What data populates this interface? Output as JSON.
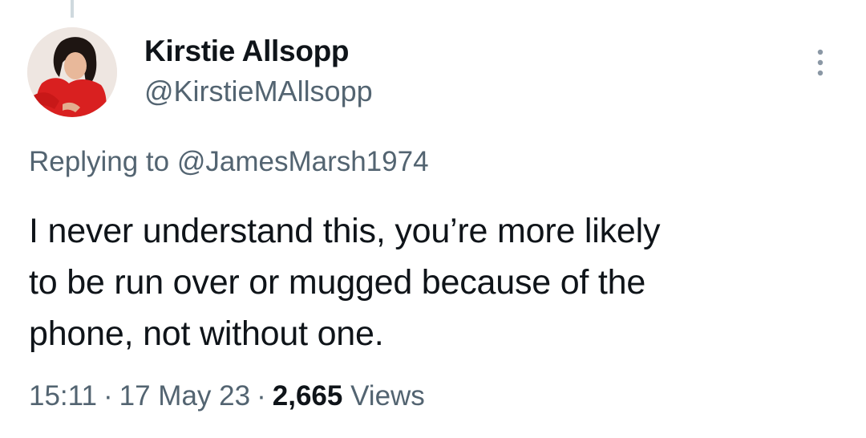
{
  "author": {
    "display_name": "Kirstie Allsopp",
    "handle": "@KirstieMAllsopp"
  },
  "reply": {
    "prefix": "Replying to ",
    "to_handle": "@JamesMarsh1974"
  },
  "tweet": {
    "text": "I never understand this, you’re more likely\nto be run over or mugged because of the\nphone, not without one."
  },
  "meta": {
    "time": "15:11",
    "date": "17 May 23",
    "views_count": "2,665",
    "views_label": "Views",
    "separator": "·"
  },
  "icons": {
    "more": "more-vertical-icon"
  },
  "colors": {
    "primary_text": "#0f1419",
    "secondary_text": "#536471",
    "thread_line": "#cfd9de",
    "background": "#ffffff"
  }
}
